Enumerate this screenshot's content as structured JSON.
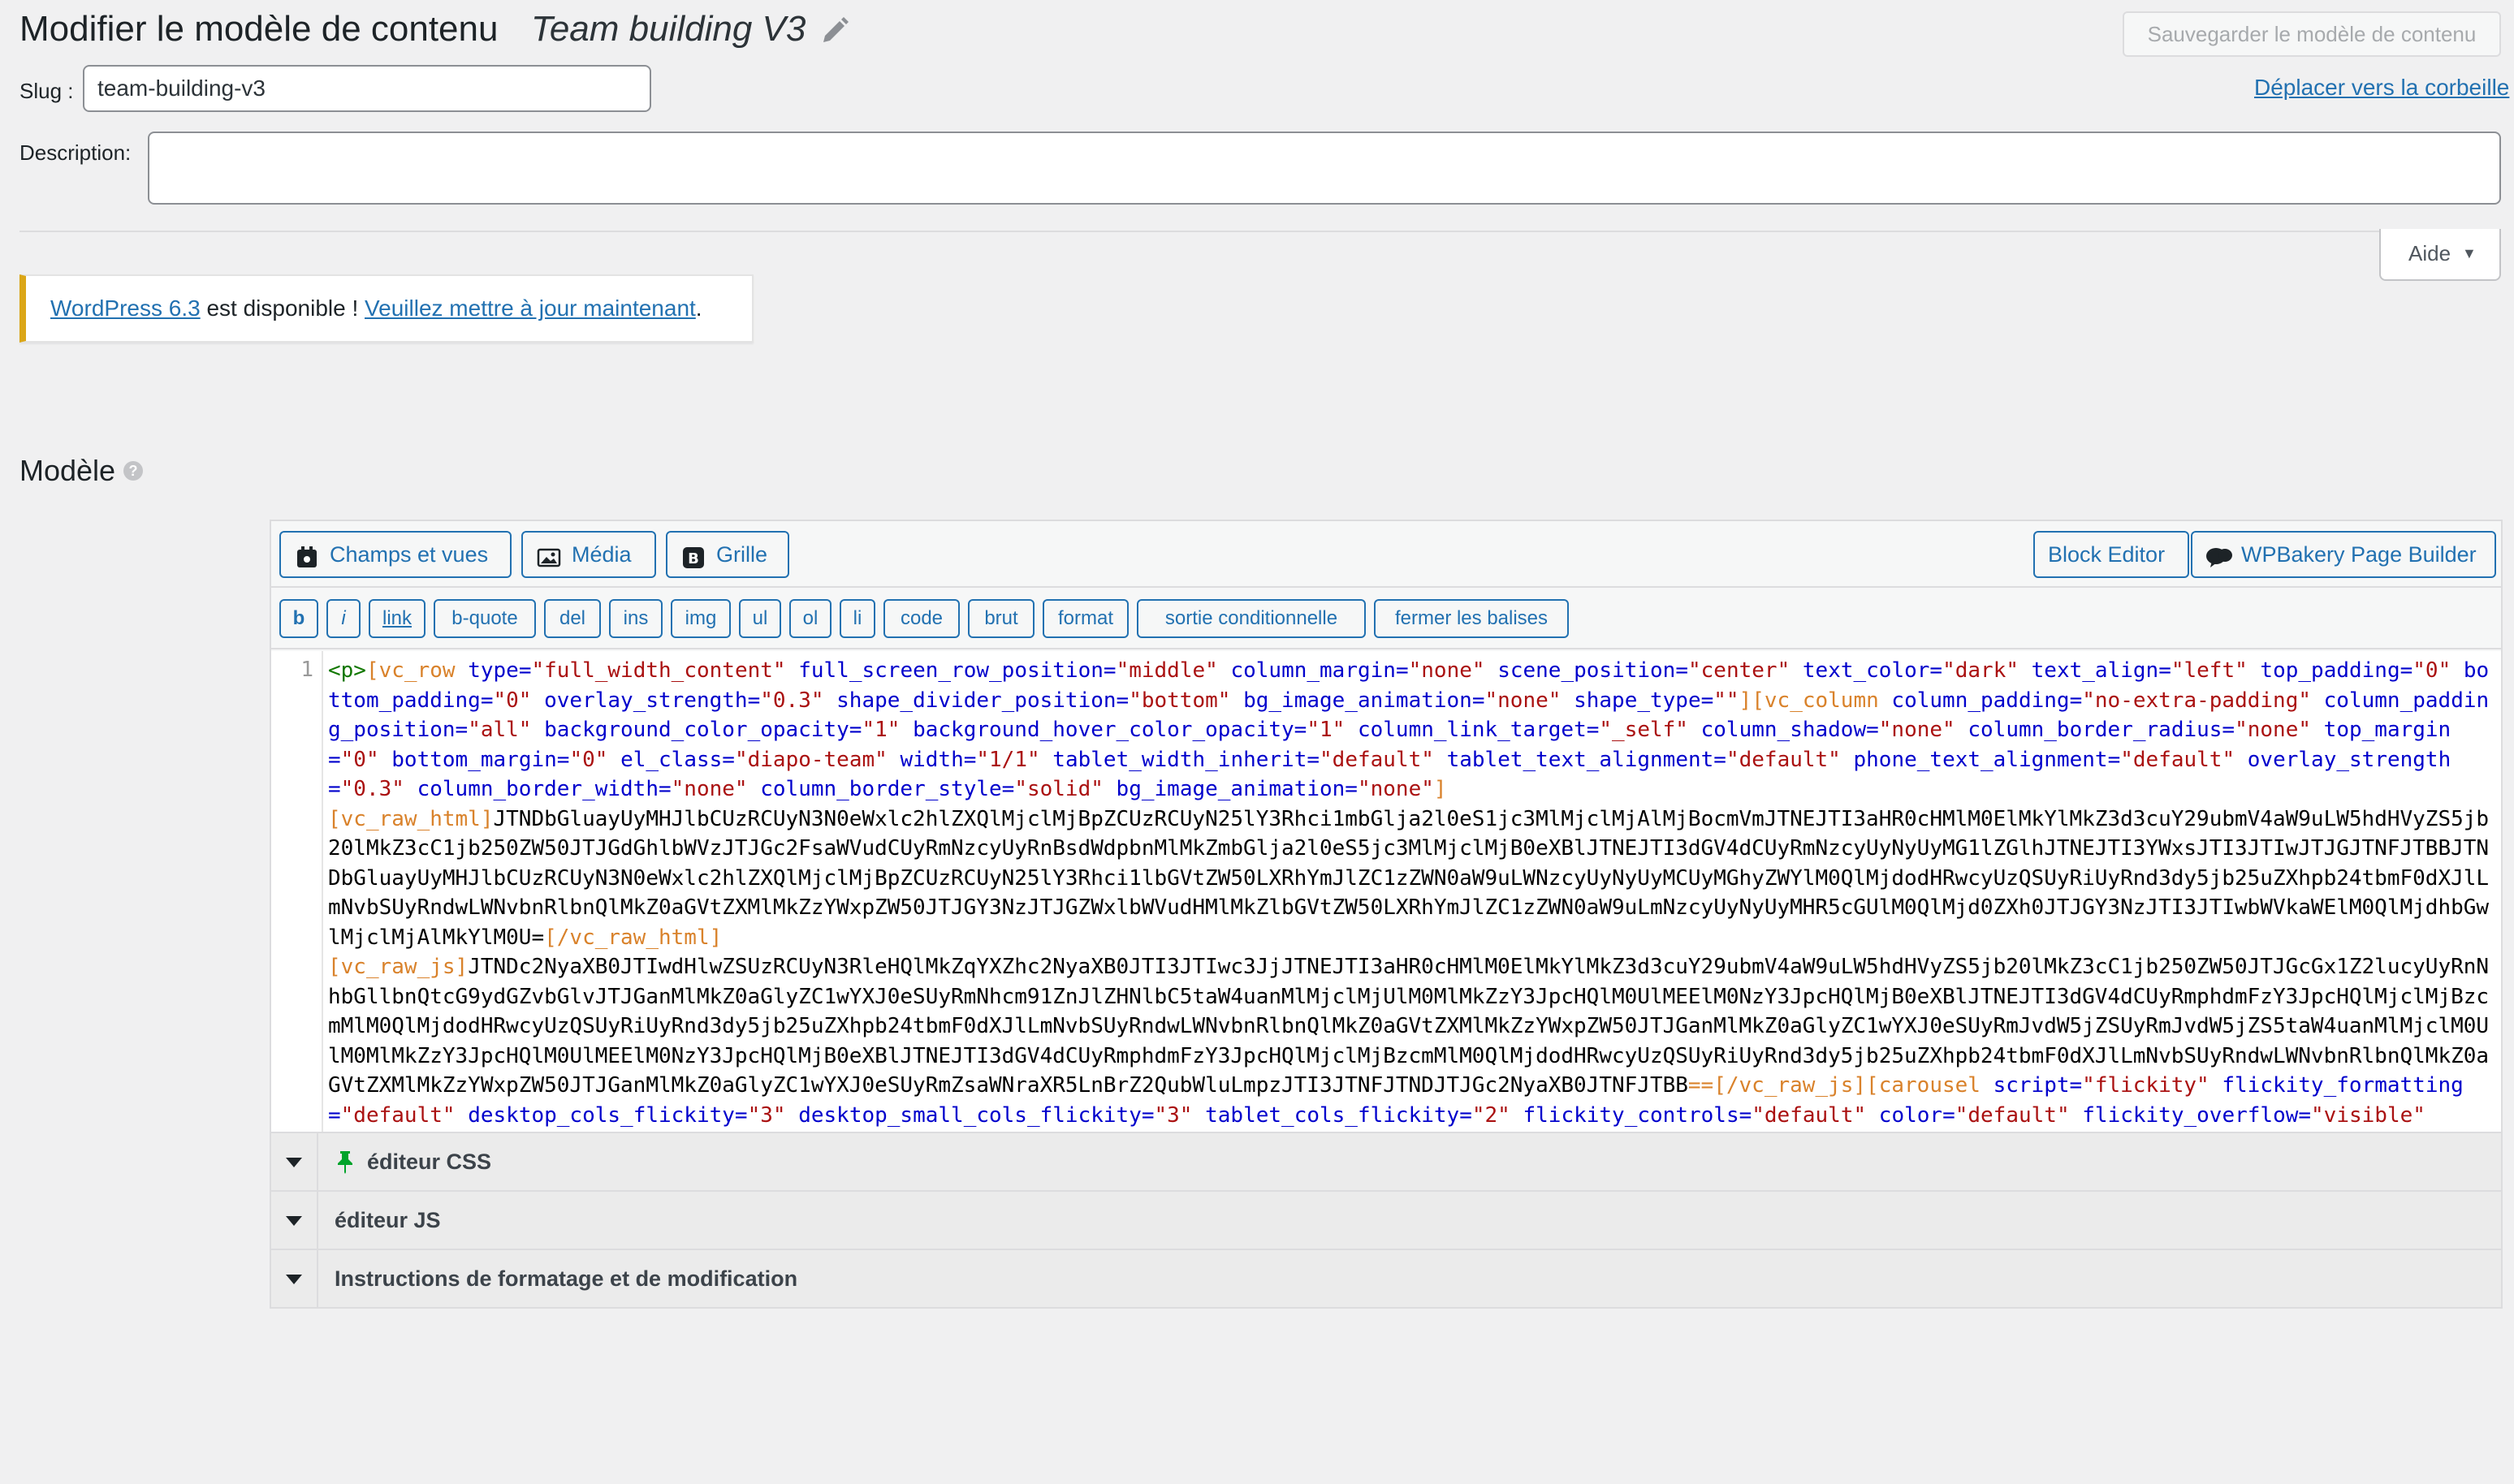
{
  "header": {
    "title": "Modifier le modèle de contenu",
    "template_name": "Team building V3",
    "save_label": "Sauvegarder le modèle de contenu",
    "slug_label": "Slug :",
    "slug_value": "team-building-v3",
    "trash_label": "Déplacer vers la corbeille",
    "description_label": "Description:",
    "description_value": "",
    "help_label": "Aide"
  },
  "notice": {
    "link1": "WordPress 6.3",
    "text": " est disponible ! ",
    "link2": "Veuillez mettre à jour maintenant",
    "end": "."
  },
  "model": {
    "title": "Modèle",
    "help_icon": "?"
  },
  "toolbar": {
    "fields_label": "Champs et vues",
    "media_label": "Média",
    "grid_label": "Grille",
    "block_editor_label": "Block Editor",
    "wpbakery_label": "WPBakery Page Builder"
  },
  "quicktags": [
    "b",
    "i",
    "link",
    "b-quote",
    "del",
    "ins",
    "img",
    "ul",
    "ol",
    "li",
    "code",
    "brut",
    "format",
    "sortie conditionnelle",
    "fermer les balises"
  ],
  "code": {
    "line_number": "1",
    "tokens": [
      {
        "t": "tag",
        "v": "<p>"
      },
      {
        "t": "sc",
        "v": "[vc_row "
      },
      {
        "t": "attr",
        "v": "type="
      },
      {
        "t": "val",
        "v": "\"full_width_content\" "
      },
      {
        "t": "attr",
        "v": "full_screen_row_position="
      },
      {
        "t": "val",
        "v": "\"middle\" "
      },
      {
        "t": "attr",
        "v": "column_margin="
      },
      {
        "t": "val",
        "v": "\"none\" "
      },
      {
        "t": "attr",
        "v": "scene_position="
      },
      {
        "t": "val",
        "v": "\"center\" "
      },
      {
        "t": "attr",
        "v": "text_color="
      },
      {
        "t": "val",
        "v": "\"dark\" "
      },
      {
        "t": "attr",
        "v": "text_align="
      },
      {
        "t": "val",
        "v": "\"left\" "
      },
      {
        "t": "attr",
        "v": "top_padding="
      },
      {
        "t": "val",
        "v": "\"0\" "
      },
      {
        "t": "attr",
        "v": "bottom_padding="
      },
      {
        "t": "val",
        "v": "\"0\" "
      },
      {
        "t": "attr",
        "v": "overlay_strength="
      },
      {
        "t": "val",
        "v": "\"0.3\" "
      },
      {
        "t": "attr",
        "v": "shape_divider_position="
      },
      {
        "t": "val",
        "v": "\"bottom\" "
      },
      {
        "t": "attr",
        "v": "bg_image_animation="
      },
      {
        "t": "val",
        "v": "\"none\" "
      },
      {
        "t": "attr",
        "v": "shape_type="
      },
      {
        "t": "val",
        "v": "\"\""
      },
      {
        "t": "sc",
        "v": "][vc_column "
      },
      {
        "t": "attr",
        "v": "column_padding="
      },
      {
        "t": "val",
        "v": "\"no-extra-padding\" "
      },
      {
        "t": "attr",
        "v": "column_padding_position="
      },
      {
        "t": "val",
        "v": "\"all\" "
      },
      {
        "t": "attr",
        "v": "background_color_opacity="
      },
      {
        "t": "val",
        "v": "\"1\" "
      },
      {
        "t": "attr",
        "v": "background_hover_color_opacity="
      },
      {
        "t": "val",
        "v": "\"1\" "
      },
      {
        "t": "attr",
        "v": "column_link_target="
      },
      {
        "t": "val",
        "v": "\"_self\" "
      },
      {
        "t": "attr",
        "v": "column_shadow="
      },
      {
        "t": "val",
        "v": "\"none\" "
      },
      {
        "t": "attr",
        "v": "column_border_radius="
      },
      {
        "t": "val",
        "v": "\"none\" "
      },
      {
        "t": "attr",
        "v": "top_margin="
      },
      {
        "t": "val",
        "v": "\"0\" "
      },
      {
        "t": "attr",
        "v": "bottom_margin="
      },
      {
        "t": "val",
        "v": "\"0\" "
      },
      {
        "t": "attr",
        "v": "el_class="
      },
      {
        "t": "val",
        "v": "\"diapo-team\" "
      },
      {
        "t": "attr",
        "v": "width="
      },
      {
        "t": "val",
        "v": "\"1/1\" "
      },
      {
        "t": "attr",
        "v": "tablet_width_inherit="
      },
      {
        "t": "val",
        "v": "\"default\" "
      },
      {
        "t": "attr",
        "v": "tablet_text_alignment="
      },
      {
        "t": "val",
        "v": "\"default\" "
      },
      {
        "t": "attr",
        "v": "phone_text_alignment="
      },
      {
        "t": "val",
        "v": "\"default\" "
      },
      {
        "t": "attr",
        "v": "overlay_strength="
      },
      {
        "t": "val",
        "v": "\"0.3\" "
      },
      {
        "t": "attr",
        "v": "column_border_width="
      },
      {
        "t": "val",
        "v": "\"none\" "
      },
      {
        "t": "attr",
        "v": "column_border_style="
      },
      {
        "t": "val",
        "v": "\"solid\" "
      },
      {
        "t": "attr",
        "v": "bg_image_animation="
      },
      {
        "t": "val",
        "v": "\"none\""
      },
      {
        "t": "sc",
        "v": "]\n"
      },
      {
        "t": "sc",
        "v": "[vc_raw_html]"
      },
      {
        "t": "text",
        "v": "JTNDbGluayUyMHJlbCUzRCUyN3N0eWxlc2hlZXQlMjclMjBpZCUzRCUyN25lY3Rhci1mbGlja2l0eS1jc3MlMjclMjAlMjBocmVmJTNEJTI3aHR0cHMlM0ElMkYlMkZ3d3cuY29ubmV4aW9uLW5hdHVyZS5jb20lMkZ3cC1jb250ZW50JTJGdGhlbWVzJTJGc2FsaWVudCUyRmNzcyUyRnBsdWdpbnMlMkZmbGlja2l0eS5jc3MlMjclMjB0eXBlJTNEJTI3dGV4dCUyRmNzcyUyNyUyMG1lZGlhJTNEJTI3YWxsJTI3JTIwJTJGJTNFJTBBJTNDbGluayUyMHJlbCUzRCUyN3N0eWxlc2hlZXQlMjclMjBpZCUzRCUyN25lY3Rhci1lbGVtZW50LXRhYmJlZC1zZWN0aW9uLWNzcyUyNyUyMCUyMGhyZWYlM0QlMjdodHRwcyUzQSUyRiUyRnd3dy5jb25uZXhpb24tbmF0dXJlLmNvbSUyRndwLWNvbnRlbnQlMkZ0aGVtZXMlMkZzYWxpZW50JTJGY3NzJTJGZWxlbWVudHMlMkZlbGVtZW50LXRhYmJlZC1zZWN0aW9uLmNzcyUyNyUyMHR5cGUlM0QlMjd0ZXh0JTJGY3NzJTI3JTIwbWVkaWElM0QlMjdhbGwlMjclMjAlMkYlM0U="
      },
      {
        "t": "sc",
        "v": "[/vc_raw_html]\n"
      },
      {
        "t": "sc",
        "v": "[vc_raw_js]"
      },
      {
        "t": "text",
        "v": "JTNDc2NyaXB0JTIwdHlwZSUzRCUyN3RleHQlMkZqYXZhc2NyaXB0JTI3JTIwc3JjJTNEJTI3aHR0cHMlM0ElMkYlMkZ3d3cuY29ubmV4aW9uLW5hdHVyZS5jb20lMkZ3cC1jb250ZW50JTJGcGx1Z2lucyUyRnNhbGllbnQtcG9ydGZvbGlvJTJGanMlMkZ0aGlyZC1wYXJ0eSUyRmNhcm91ZnJlZHNlbC5taW4uanMlMjclMjUlM0MlMkZzY3JpcHQlM0UlMEElM0NzY3JpcHQlMjB0eXBlJTNEJTI3dGV4dCUyRmphdmFzY3JpcHQlMjclMjBzcmMlM0QlMjdodHRwcyUzQSUyRiUyRnd3dy5jb25uZXhpb24tbmF0dXJlLmNvbSUyRndwLWNvbnRlbnQlMkZ0aGVtZXMlMkZzYWxpZW50JTJGanMlMkZ0aGlyZC1wYXJ0eSUyRmJvdW5jZSUyRmJvdW5jZS5taW4uanMlMjclM0UlM0MlMkZzY3JpcHQlM0UlMEElM0NzY3JpcHQlMjB0eXBlJTNEJTI3dGV4dCUyRmphdmFzY3JpcHQlMjclMjBzcmMlM0QlMjdodHRwcyUzQSUyRiUyRnd3dy5jb25uZXhpb24tbmF0dXJlLmNvbSUyRndwLWNvbnRlbnQlMkZ0aGVtZXMlMkZzYWxpZW50JTJGanMlMkZ0aGlyZC1wYXJ0eSUyRmZsaWNraXR5LnBrZ2QubWluLmpzJTI3JTNFJTNDJTJGc2NyaXB0JTNFJTBB"
      },
      {
        "t": "sc",
        "v": "==[/vc_raw_js][carousel "
      },
      {
        "t": "attr",
        "v": "script="
      },
      {
        "t": "val",
        "v": "\"flickity\" "
      },
      {
        "t": "attr",
        "v": "flickity_formatting="
      },
      {
        "t": "val",
        "v": "\"default\" "
      },
      {
        "t": "attr",
        "v": "desktop_cols_flickity="
      },
      {
        "t": "val",
        "v": "\"3\" "
      },
      {
        "t": "attr",
        "v": "desktop_small_cols_flickity="
      },
      {
        "t": "val",
        "v": "\"3\" "
      },
      {
        "t": "attr",
        "v": "tablet_cols_flickity="
      },
      {
        "t": "val",
        "v": "\"2\" "
      },
      {
        "t": "attr",
        "v": "flickity_controls="
      },
      {
        "t": "val",
        "v": "\"default\" "
      },
      {
        "t": "attr",
        "v": "color="
      },
      {
        "t": "val",
        "v": "\"default\" "
      },
      {
        "t": "attr",
        "v": "flickity_overflow="
      },
      {
        "t": "val",
        "v": "\"visible\""
      }
    ]
  },
  "panels": [
    {
      "label": "éditeur CSS",
      "icon": "pin-icon"
    },
    {
      "label": "éditeur JS"
    },
    {
      "label": "Instructions de formatage et de modification"
    }
  ],
  "colors": {
    "accent": "#2271b1",
    "notice_border": "#dba617",
    "pin": "#00a32a"
  }
}
